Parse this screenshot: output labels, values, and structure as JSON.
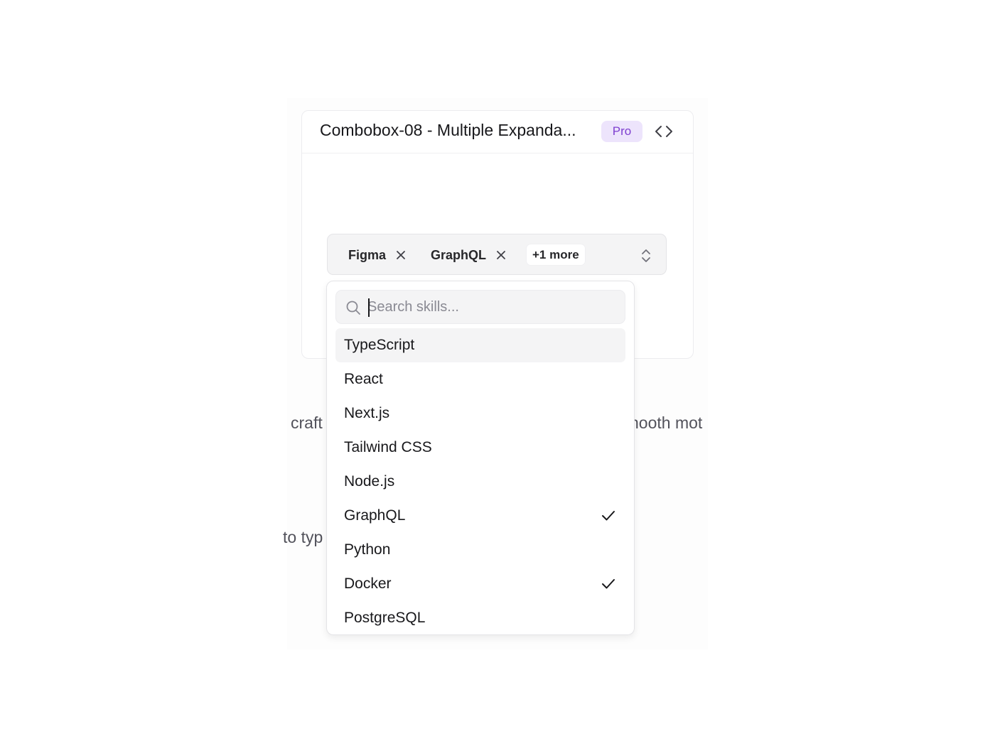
{
  "background": {
    "fragments": [
      {
        "text": "craft"
      },
      {
        "text": "nooth mot"
      },
      {
        "text": "to typ"
      }
    ]
  },
  "card": {
    "title": "Combobox-08 - Multiple Expanda...",
    "badge": "Pro",
    "code_icon": "code-icon"
  },
  "combobox": {
    "selected": [
      {
        "label": "Figma"
      },
      {
        "label": "GraphQL"
      }
    ],
    "more_label": "+1 more",
    "chevron_icon": "chevron-up-down-icon"
  },
  "dropdown": {
    "search_placeholder": "Search skills...",
    "search_value": "",
    "options": [
      {
        "label": "TypeScript",
        "checked": false,
        "highlighted": true
      },
      {
        "label": "React",
        "checked": false,
        "highlighted": false
      },
      {
        "label": "Next.js",
        "checked": false,
        "highlighted": false
      },
      {
        "label": "Tailwind CSS",
        "checked": false,
        "highlighted": false
      },
      {
        "label": "Node.js",
        "checked": false,
        "highlighted": false
      },
      {
        "label": "GraphQL",
        "checked": true,
        "highlighted": false
      },
      {
        "label": "Python",
        "checked": false,
        "highlighted": false
      },
      {
        "label": "Docker",
        "checked": true,
        "highlighted": false
      },
      {
        "label": "PostgreSQL",
        "checked": false,
        "highlighted": false
      }
    ]
  },
  "colors": {
    "accent_badge_bg": "#ede4fc",
    "accent_badge_text": "#7e3fd0",
    "highlight_bg": "#f4f4f5"
  }
}
